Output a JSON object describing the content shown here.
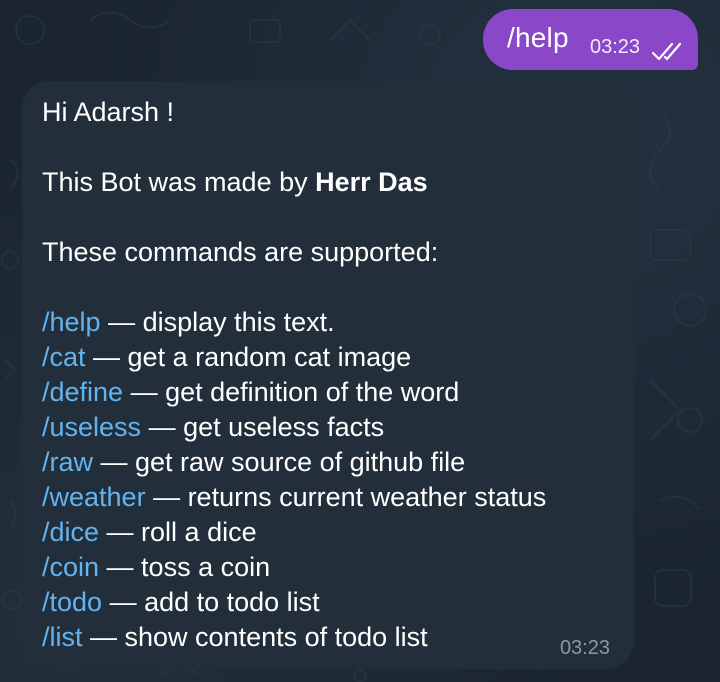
{
  "outgoing": {
    "text": "/help",
    "time": "03:23",
    "read_icon": "double-check-icon",
    "bubble_color": "#8a48c8"
  },
  "incoming": {
    "greeting": "Hi Adarsh !",
    "made_by_prefix": "This Bot was made by ",
    "made_by_name": "Herr Das",
    "supported_heading": "These commands are supported:",
    "commands": [
      {
        "cmd": "/help",
        "desc": " — display this text."
      },
      {
        "cmd": "/cat",
        "desc": " — get a random cat image"
      },
      {
        "cmd": "/define",
        "desc": " — get definition of the word"
      },
      {
        "cmd": "/useless",
        "desc": " — get useless facts"
      },
      {
        "cmd": "/raw",
        "desc": " — get raw source of github file"
      },
      {
        "cmd": "/weather",
        "desc": " — returns current weather status"
      },
      {
        "cmd": "/dice",
        "desc": " — roll a dice"
      },
      {
        "cmd": "/coin",
        "desc": " — toss a coin"
      },
      {
        "cmd": "/todo",
        "desc": " — add to todo list"
      },
      {
        "cmd": "/list",
        "desc": " — show contents of todo list"
      }
    ],
    "time": "03:23",
    "bubble_color": "#222f3b",
    "link_color": "#62b3f0"
  }
}
